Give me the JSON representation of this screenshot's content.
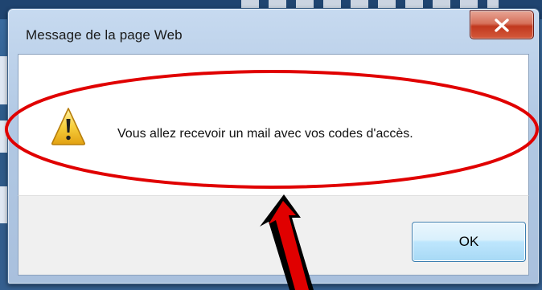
{
  "dialog": {
    "title": "Message de la page Web",
    "message": "Vous allez recevoir un mail avec vos codes d'accès.",
    "ok_label": "OK",
    "close_glyph": "x",
    "icon": "warning-icon"
  },
  "annotation": {
    "color": "#e00000",
    "shape": "ellipse-highlight",
    "pointer": "arrow"
  }
}
